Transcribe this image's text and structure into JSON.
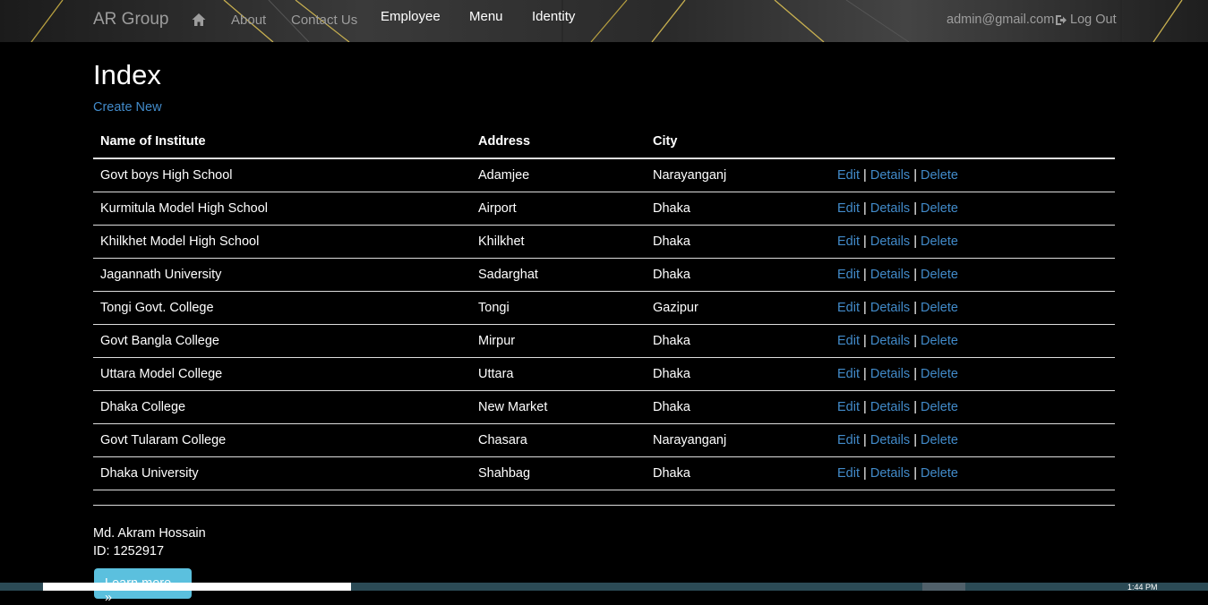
{
  "navbar": {
    "brand": "AR Group",
    "links": [
      {
        "label": "About"
      },
      {
        "label": "Contact Us"
      },
      {
        "label": "Employee"
      },
      {
        "label": "Menu"
      },
      {
        "label": "Identity"
      }
    ],
    "user_email": "admin@gmail.com",
    "logout_label": "Log Out"
  },
  "page": {
    "title": "Index",
    "create_new": "Create New"
  },
  "table": {
    "headers": [
      "Name of Institute",
      "Address",
      "City",
      ""
    ],
    "rows": [
      {
        "name": "Govt boys High School",
        "address": "Adamjee",
        "city": "Narayanganj"
      },
      {
        "name": "Kurmitula Model High School",
        "address": "Airport",
        "city": "Dhaka"
      },
      {
        "name": "Khilkhet Model High School",
        "address": "Khilkhet",
        "city": "Dhaka"
      },
      {
        "name": "Jagannath University",
        "address": "Sadarghat",
        "city": "Dhaka"
      },
      {
        "name": "Tongi Govt. College",
        "address": "Tongi",
        "city": "Gazipur"
      },
      {
        "name": "Govt Bangla College",
        "address": "Mirpur",
        "city": "Dhaka"
      },
      {
        "name": "Uttara Model College",
        "address": "Uttara",
        "city": "Dhaka"
      },
      {
        "name": "Dhaka College",
        "address": "New Market",
        "city": "Dhaka"
      },
      {
        "name": "Govt Tularam College",
        "address": "Chasara",
        "city": "Narayanganj"
      },
      {
        "name": "Dhaka University",
        "address": "Shahbag",
        "city": "Dhaka"
      }
    ],
    "actions": {
      "edit": "Edit",
      "details": "Details",
      "delete": "Delete",
      "separator": "|"
    }
  },
  "footer": {
    "name": "Md. Akram Hossain",
    "id": "ID: 1252917",
    "learn_more": "Learn more »"
  },
  "taskbar": {
    "time": "1:44 PM"
  },
  "colors": {
    "link": "#428bca",
    "nav_muted": "#9d9d9d",
    "learn_button": "#5bc0de"
  },
  "icons": {
    "home": "home-icon",
    "logout": "logout-icon"
  }
}
